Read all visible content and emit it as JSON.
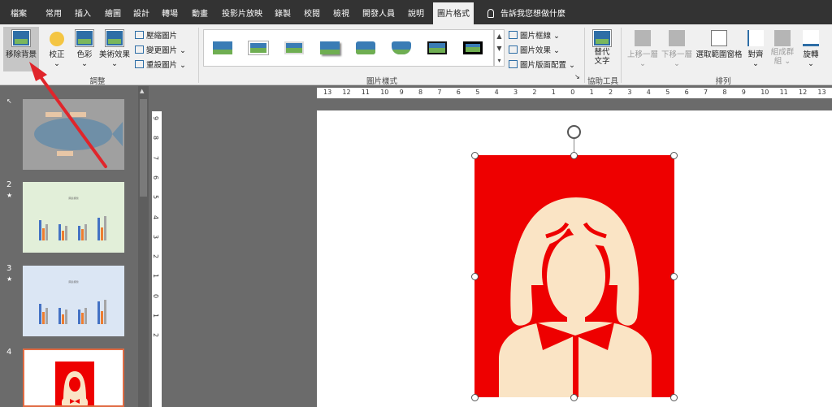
{
  "tabs": [
    "檔案",
    "常用",
    "插入",
    "繪圖",
    "設計",
    "轉場",
    "動畫",
    "投影片放映",
    "錄製",
    "校閱",
    "檢視",
    "開發人員",
    "說明",
    "圖片格式"
  ],
  "tell_me": "告訴我您想做什麼",
  "ribbon": {
    "remove_bg": "移除背景",
    "correct": "校正",
    "color": "色彩",
    "artistic": "美術效果",
    "compress": "壓縮圖片",
    "change": "變更圖片",
    "reset": "重設圖片",
    "group_adjust": "調整",
    "border": "圖片框線",
    "effects": "圖片效果",
    "layout": "圖片版面配置",
    "group_styles": "圖片樣式",
    "alt_text_1": "替代",
    "alt_text_2": "文字",
    "group_access": "協助工具",
    "bring_forward": "上移一層",
    "send_backward": "下移一層",
    "selection_pane": "選取範圍窗格",
    "align": "對齊",
    "group_btn_1": "組成群",
    "group_btn_2": "組",
    "rotate": "旋轉",
    "group_arrange": "排列"
  },
  "slides": {
    "n2": "2",
    "n3": "3",
    "n4": "4",
    "star": "★",
    "chart_title": "圖表標題"
  },
  "hruler": [
    "13",
    "12",
    "11",
    "10",
    "9",
    "8",
    "7",
    "6",
    "5",
    "4",
    "3",
    "2",
    "1",
    "0",
    "1",
    "2",
    "3",
    "4",
    "5",
    "6",
    "7",
    "8",
    "9",
    "10",
    "11",
    "12",
    "13"
  ],
  "vruler": [
    "9",
    "8",
    "7",
    "6",
    "5",
    "4",
    "3",
    "2",
    "1",
    "0",
    "1",
    "2"
  ],
  "colors": {
    "accent": "#ee0000",
    "figure": "#fae4c5",
    "annotation": "#e0252b"
  }
}
